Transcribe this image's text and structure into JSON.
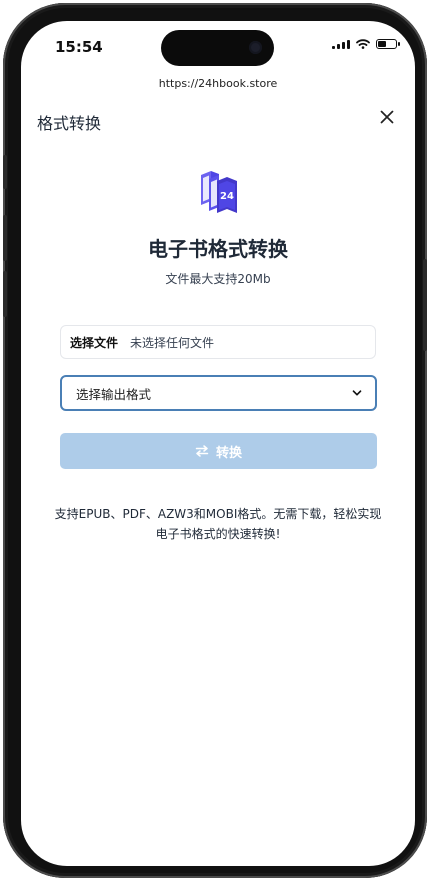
{
  "status_bar": {
    "time": "15:54",
    "icons": [
      "signal-icon",
      "wifi-icon",
      "battery-icon"
    ]
  },
  "browser": {
    "url": "https://24hbook.store"
  },
  "header": {
    "title": "格式转换",
    "close_icon": "close-icon"
  },
  "hero": {
    "logo_icon": "books-24-logo",
    "title": "电子书格式转换",
    "subtitle": "文件最大支持20Mb"
  },
  "form": {
    "file_button_label": "选择文件",
    "file_status": "未选择任何文件",
    "format_select_value": "选择输出格式",
    "convert_button_label": "转换",
    "convert_icon": "swap-arrows-icon"
  },
  "footer": {
    "note": "支持EPUB、PDF、AZW3和MOBI格式。无需下载，轻松实现电子书格式的快速转换!"
  },
  "colors": {
    "accent_border": "#4a7fb5",
    "button_disabled": "#aecce9",
    "logo_blue": "#4f46e5"
  }
}
